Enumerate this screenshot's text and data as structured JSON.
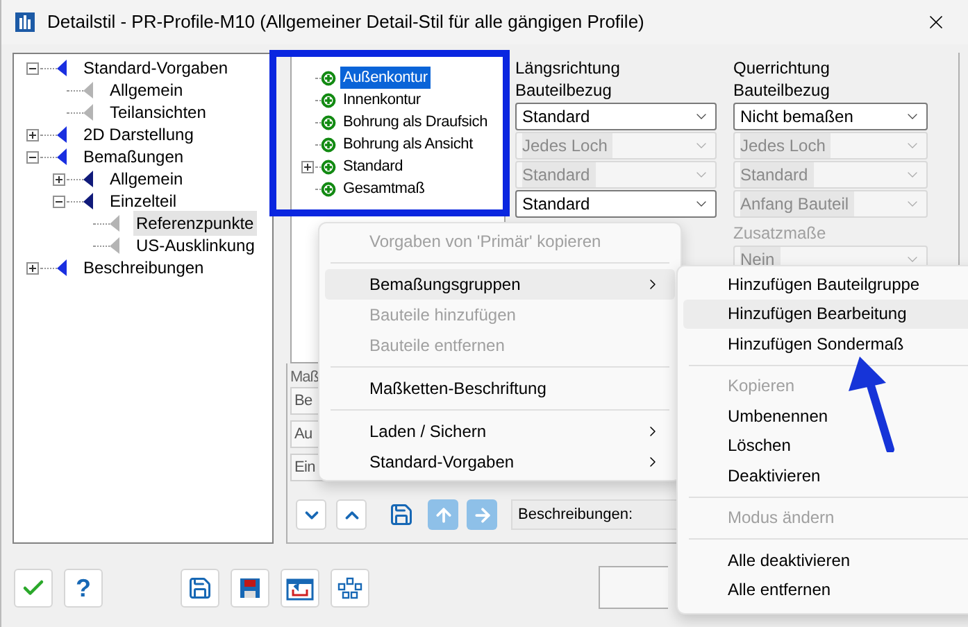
{
  "window": {
    "title": "Detailstil - PR-Profile-M10 (Allgemeiner Detail-Stil für alle gängigen Profile)"
  },
  "nav_tree": [
    {
      "label": "Standard-Vorgaben",
      "expanded": true,
      "selected": false,
      "children": [
        {
          "label": "Allgemein",
          "selected": false
        },
        {
          "label": "Teilansichten",
          "selected": false
        }
      ]
    },
    {
      "label": "2D Darstellung",
      "expanded": false,
      "selected": false
    },
    {
      "label": "Bemaßungen",
      "expanded": true,
      "selected": false,
      "children": [
        {
          "label": "Allgemein",
          "expanded": false,
          "selected": false
        },
        {
          "label": "Einzelteil",
          "expanded": true,
          "selected": false,
          "children": [
            {
              "label": "Referenzpunkte",
              "selected": true
            },
            {
              "label": "US-Ausklinkung",
              "selected": false
            }
          ]
        }
      ]
    },
    {
      "label": "Beschreibungen",
      "expanded": false,
      "selected": false
    }
  ],
  "group_tree": [
    {
      "label": "Außenkontur",
      "selected": true
    },
    {
      "label": "Innenkontur",
      "selected": false
    },
    {
      "label": "Bohrung als Draufsich",
      "selected": false
    },
    {
      "label": "Bohrung als Ansicht",
      "selected": false
    },
    {
      "label": "Standard",
      "selected": false,
      "expanded": false
    },
    {
      "label": "Gesamtmaß",
      "selected": false
    }
  ],
  "laengsrichtung": {
    "title": "Längsrichtung",
    "label": "Bauteilbezug",
    "selects": [
      {
        "value": "Standard",
        "disabled": false
      },
      {
        "value": "Jedes Loch",
        "disabled": true
      },
      {
        "value": "Standard",
        "disabled": true
      },
      {
        "value": "Standard",
        "disabled": false
      }
    ]
  },
  "querrichtung": {
    "title": "Querrichtung",
    "label": "Bauteilbezug",
    "selects": [
      {
        "value": "Nicht bemaßen",
        "disabled": false
      },
      {
        "value": "Jedes Loch",
        "disabled": true
      },
      {
        "value": "Standard",
        "disabled": true
      },
      {
        "value": "Anfang Bauteil",
        "disabled": true
      }
    ],
    "extra_label": "Zusatzmaße",
    "extra_select": {
      "value": "Nein",
      "disabled": true
    }
  },
  "measure_section": {
    "label": "Maß",
    "fields": [
      "Be",
      "Au",
      "Ein"
    ]
  },
  "description_label": "Beschreibungen:",
  "help_button": "?",
  "context_menu": [
    {
      "kind": "item",
      "label": "Vorgaben von 'Primär' kopieren",
      "disabled": true,
      "has_submenu": false,
      "selected": false
    },
    {
      "kind": "separator"
    },
    {
      "kind": "item",
      "label": "Bemaßungsgruppen",
      "disabled": false,
      "has_submenu": true,
      "selected": true
    },
    {
      "kind": "item",
      "label": "Bauteile hinzufügen",
      "disabled": true,
      "has_submenu": false,
      "selected": false
    },
    {
      "kind": "item",
      "label": "Bauteile entfernen",
      "disabled": true,
      "has_submenu": false,
      "selected": false
    },
    {
      "kind": "separator"
    },
    {
      "kind": "item",
      "label": "Maßketten-Beschriftung",
      "disabled": false,
      "has_submenu": false,
      "selected": false
    },
    {
      "kind": "separator"
    },
    {
      "kind": "item",
      "label": "Laden / Sichern",
      "disabled": false,
      "has_submenu": true,
      "selected": false
    },
    {
      "kind": "item",
      "label": "Standard-Vorgaben",
      "disabled": false,
      "has_submenu": true,
      "selected": false
    }
  ],
  "submenu": [
    {
      "kind": "item",
      "label": "Hinzufügen Bauteilgruppe",
      "disabled": false,
      "selected": false
    },
    {
      "kind": "item",
      "label": "Hinzufügen Bearbeitung",
      "disabled": false,
      "selected": true
    },
    {
      "kind": "item",
      "label": "Hinzufügen Sondermaß",
      "disabled": false,
      "selected": false
    },
    {
      "kind": "separator"
    },
    {
      "kind": "item",
      "label": "Kopieren",
      "disabled": true,
      "selected": false
    },
    {
      "kind": "item",
      "label": "Umbenennen",
      "disabled": false,
      "selected": false
    },
    {
      "kind": "item",
      "label": "Löschen",
      "disabled": false,
      "selected": false
    },
    {
      "kind": "item",
      "label": "Deaktivieren",
      "disabled": false,
      "selected": false
    },
    {
      "kind": "separator"
    },
    {
      "kind": "item",
      "label": "Modus ändern",
      "disabled": true,
      "selected": false
    },
    {
      "kind": "separator"
    },
    {
      "kind": "item",
      "label": "Alle deaktivieren",
      "disabled": false,
      "selected": false
    },
    {
      "kind": "item",
      "label": "Alle entfernen",
      "disabled": false,
      "selected": false
    }
  ]
}
